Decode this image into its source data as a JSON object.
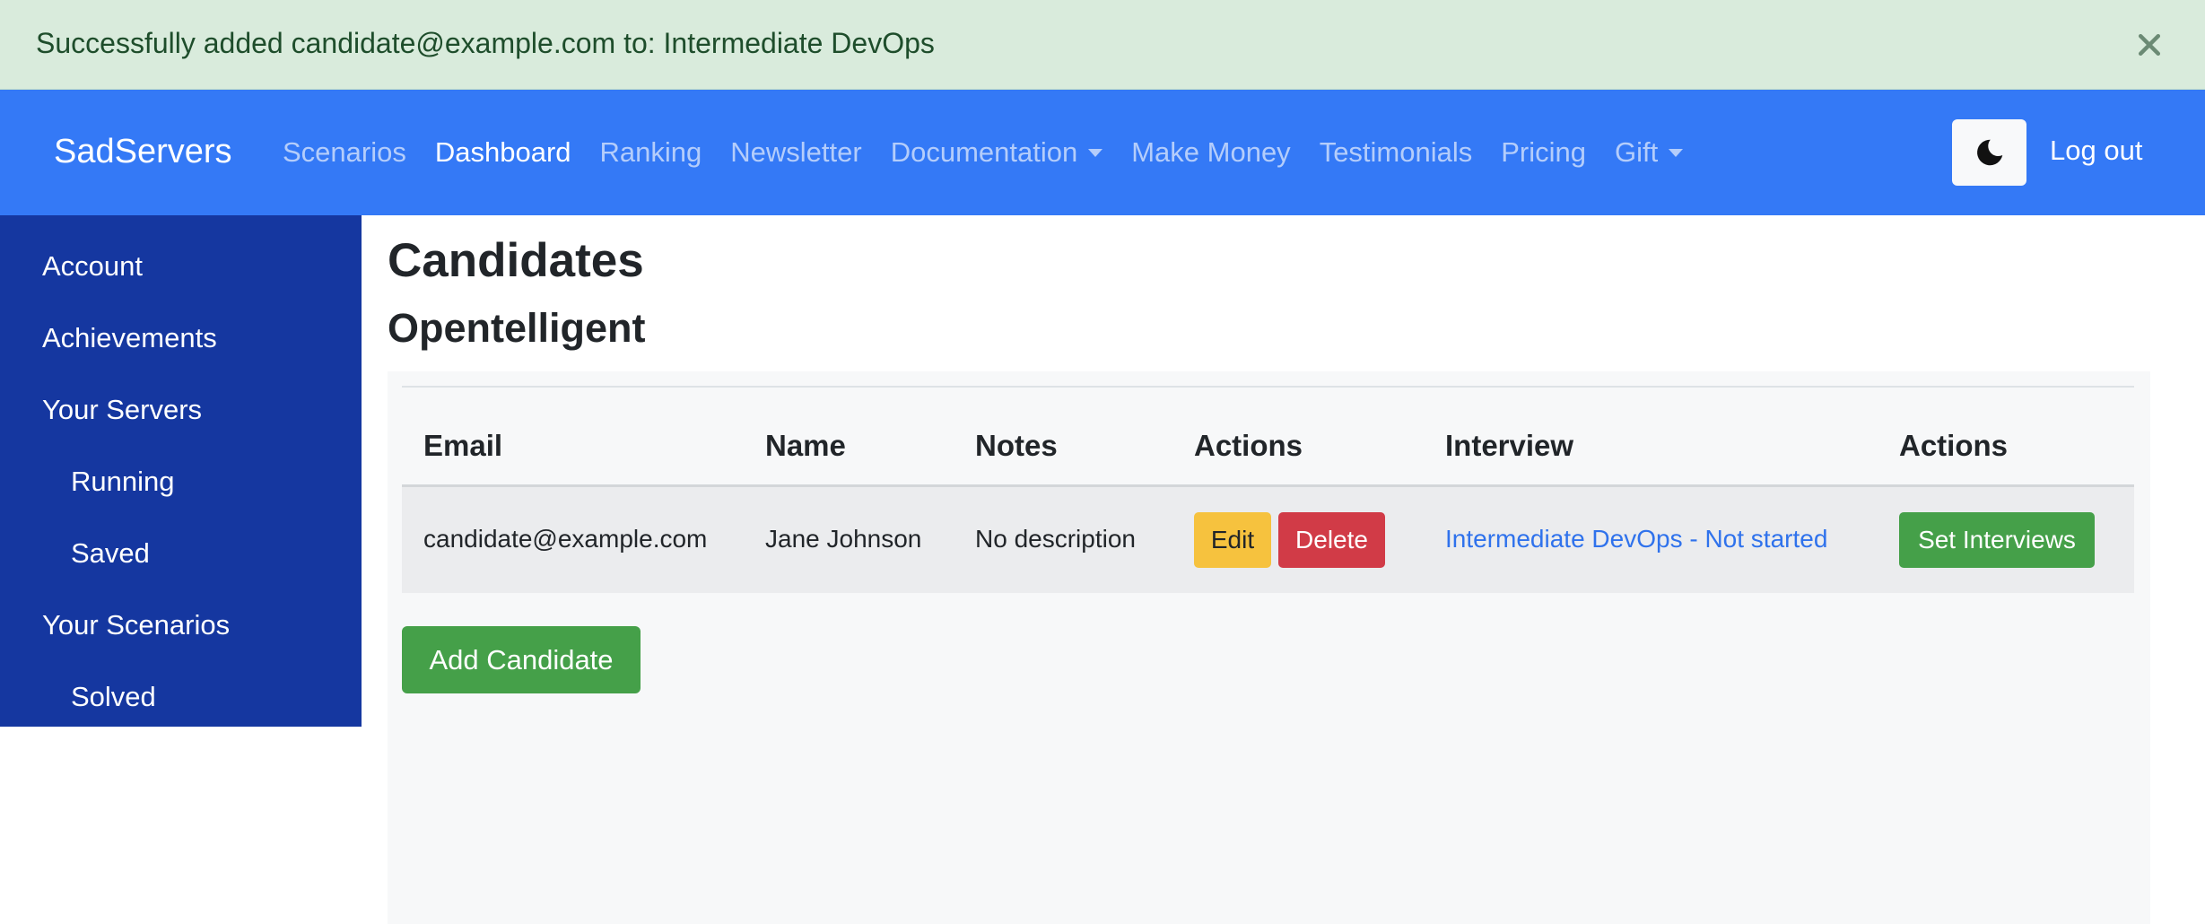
{
  "alert": {
    "message": "Successfully added candidate@example.com to: Intermediate DevOps",
    "close_icon": "close-icon"
  },
  "navbar": {
    "brand": "SadServers",
    "links": [
      {
        "label": "Scenarios"
      },
      {
        "label": "Dashboard",
        "active": true
      },
      {
        "label": "Ranking"
      },
      {
        "label": "Newsletter"
      },
      {
        "label": "Documentation",
        "dropdown": true
      },
      {
        "label": "Make Money"
      },
      {
        "label": "Testimonials"
      },
      {
        "label": "Pricing"
      },
      {
        "label": "Gift",
        "dropdown": true
      }
    ],
    "theme_toggle_icon": "moon-icon",
    "logout": "Log out"
  },
  "sidebar": {
    "items": [
      {
        "label": "Account"
      },
      {
        "label": "Achievements"
      },
      {
        "label": "Your Servers"
      },
      {
        "label": "Running"
      },
      {
        "label": "Saved"
      },
      {
        "label": "Your Scenarios"
      },
      {
        "label": "Solved"
      }
    ]
  },
  "main": {
    "title": "Candidates",
    "subtitle": "Opentelligent",
    "table": {
      "headers": [
        "Email",
        "Name",
        "Notes",
        "Actions",
        "Interview",
        "Actions"
      ],
      "rows": [
        {
          "email": "candidate@example.com",
          "name": "Jane Johnson",
          "notes": "No description",
          "edit": "Edit",
          "delete": "Delete",
          "interview": "Intermediate DevOps - Not started",
          "set_interviews": "Set Interviews"
        }
      ]
    },
    "add_candidate": "Add Candidate"
  },
  "colors": {
    "alert_bg": "#d9ebdc",
    "navbar_bg": "#3479f6",
    "sidebar_bg": "#1537a0",
    "edit_button": "#f6c23e",
    "delete_button": "#d13b47",
    "success_button": "#45a049",
    "link": "#2f72ec"
  }
}
